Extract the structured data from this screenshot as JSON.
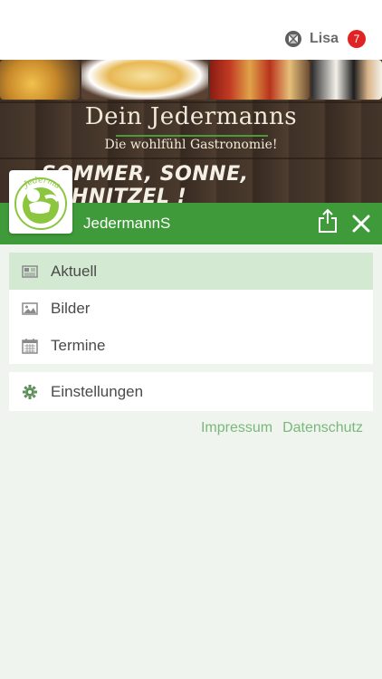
{
  "header": {
    "user_name": "Lisa",
    "notification_count": "7",
    "badge_color": "#e02424"
  },
  "banner": {
    "title": "Dein Jedermanns",
    "subtitle": "Die wohlfühl Gastronomie!",
    "slogan": "SOMMER, SONNE, SCHNITZEL !"
  },
  "bar": {
    "brand_name": "JedermannS",
    "accent_color": "#3f9a3a"
  },
  "logo": {
    "text": "Jedermanns",
    "icon": "jedermanns-logo"
  },
  "menu": {
    "items": [
      {
        "label": "Aktuell",
        "icon": "newspaper-icon",
        "active": true
      },
      {
        "label": "Bilder",
        "icon": "image-icon",
        "active": false
      },
      {
        "label": "Termine",
        "icon": "calendar-icon",
        "active": false
      }
    ],
    "settings": {
      "label": "Einstellungen",
      "icon": "gear-icon"
    }
  },
  "footer": {
    "impressum": "Impressum",
    "datenschutz": "Datenschutz"
  }
}
